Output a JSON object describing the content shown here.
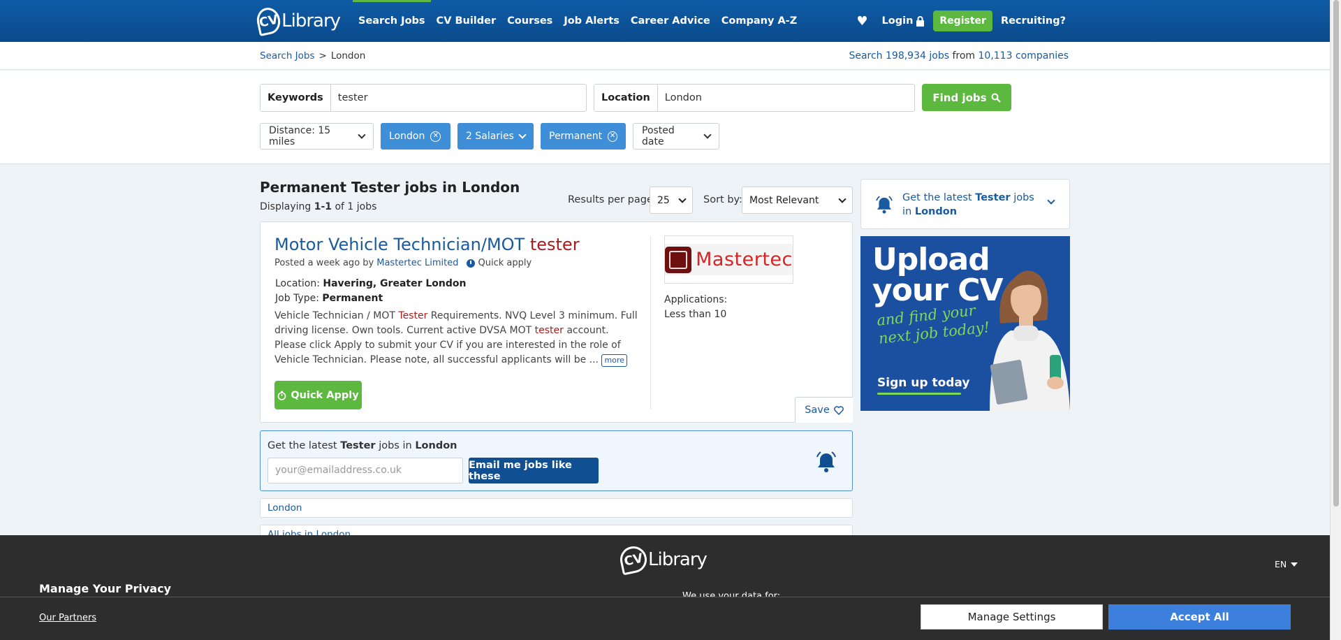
{
  "header": {
    "logo_cv": "CV",
    "logo_library": "Library",
    "nav": [
      "Search Jobs",
      "CV Builder",
      "Courses",
      "Job Alerts",
      "Career Advice",
      "Company A-Z"
    ],
    "login": "Login",
    "register": "Register",
    "recruiting": "Recruiting?"
  },
  "breadcrumb": {
    "home": "Search Jobs",
    "separator": ">",
    "current": "London"
  },
  "stats": {
    "prefix": "Search",
    "jobs_count": "198,934",
    "jobs_word": "jobs",
    "from": "from",
    "companies_count": "10,113",
    "companies_word": "companies"
  },
  "search": {
    "keywords_label": "Keywords",
    "keywords_value": "tester",
    "location_label": "Location",
    "location_value": "London",
    "find_button": "Find jobs"
  },
  "filters": {
    "distance": "Distance: 15 miles",
    "location_chip": "London",
    "salaries_chip": "2 Salaries",
    "type_chip": "Permanent",
    "posted_date": "Posted date"
  },
  "results": {
    "title": "Permanent Tester jobs in London",
    "displaying_prefix": "Displaying",
    "range": "1-1",
    "of_text": "of 1 jobs",
    "per_page_label": "Results per page:",
    "per_page_value": "25",
    "sort_label": "Sort by:",
    "sort_value": "Most Relevant"
  },
  "job": {
    "title_main": "Motor Vehicle Technician/MOT",
    "title_highlight": "tester",
    "posted_text": "Posted a week ago by",
    "company": "Mastertec Limited",
    "quick_apply_tag": "Quick apply",
    "location_label": "Location:",
    "location_value": "Havering, Greater London",
    "type_label": "Job Type:",
    "type_value": "Permanent",
    "desc_1": "Vehicle Technician / MOT ",
    "desc_hl1": "Tester",
    "desc_2": " Requirements. NVQ Level 3 minimum. Full driving license. Own tools. Current active DVSA MOT ",
    "desc_hl2": "tester",
    "desc_3": " account. Please click Apply to submit your CV if you are interested in the role of Vehicle Technician. Please note, all successful applicants will be ...",
    "more": "more",
    "quick_apply_button": "Quick Apply",
    "company_logo_text": "Mastertec",
    "applications_label": "Applications:",
    "applications_value": "Less than 10",
    "save": "Save"
  },
  "alert": {
    "text_prefix": "Get the latest",
    "keyword": "Tester",
    "text_mid": "jobs in",
    "location": "London",
    "email_placeholder": "your@emailaddress.co.uk",
    "button": "Email me jobs like these"
  },
  "related_links": [
    "London",
    "All jobs in London"
  ],
  "side_alert": {
    "prefix": "Get the latest",
    "keyword": "Tester",
    "mid": "jobs in",
    "location": "London"
  },
  "ad": {
    "line1": "Upload",
    "line2": "your CV",
    "tag1": "and find your",
    "tag2": "next job today!",
    "cta": "Sign up today"
  },
  "privacy": {
    "logo_cv": "CV",
    "logo_library": "Library",
    "language": "EN",
    "heading": "Manage Your Privacy",
    "use_data": "We use your data for:",
    "partners": "Our Partners",
    "manage_settings": "Manage Settings",
    "accept_all": "Accept All"
  }
}
